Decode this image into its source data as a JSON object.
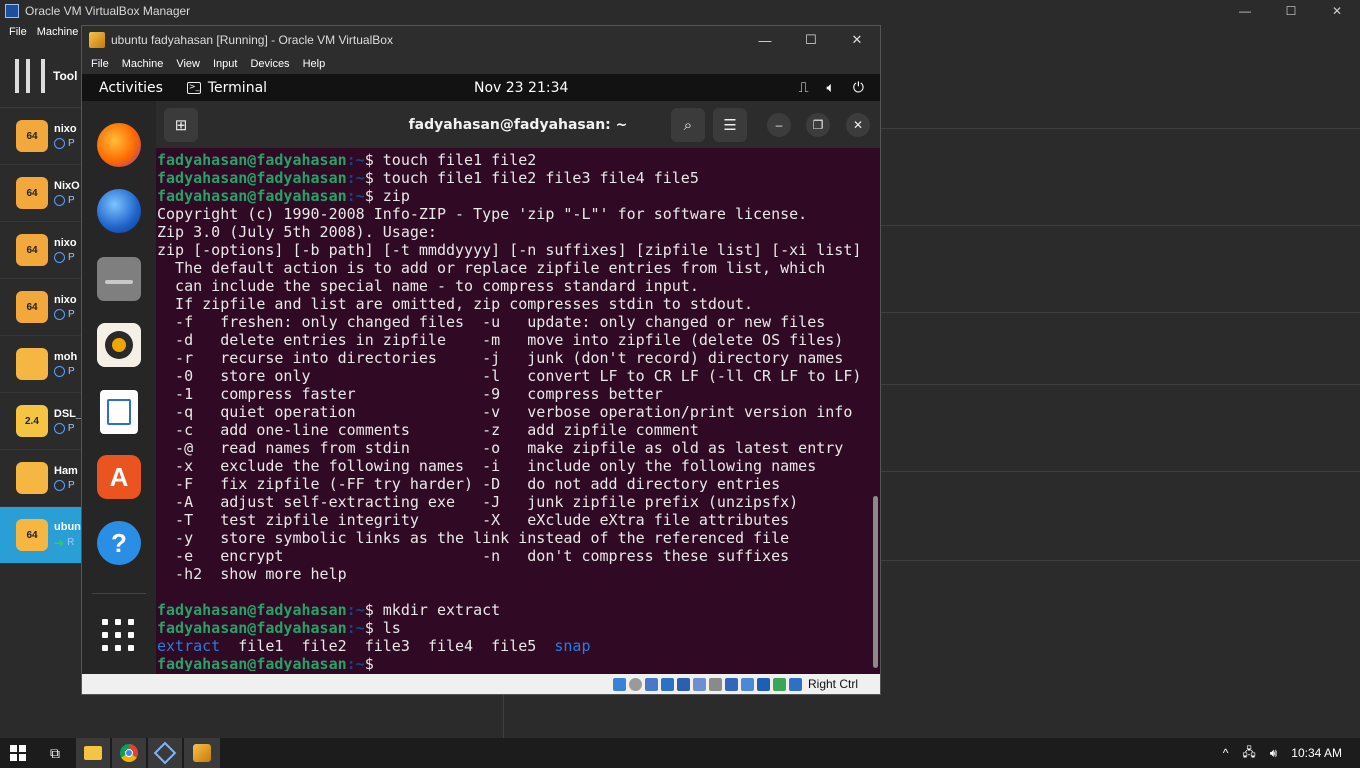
{
  "host": {
    "title": "Oracle VM VirtualBox Manager",
    "menu": [
      "File",
      "Machine"
    ],
    "tools_label": "Tool",
    "vms": [
      {
        "name": "nixo",
        "state": "P",
        "badge": "64",
        "color": "#f2a83a"
      },
      {
        "name": "NixO",
        "state": "P",
        "badge": "64",
        "color": "#f2a83a"
      },
      {
        "name": "nixo",
        "state": "P",
        "badge": "64",
        "color": "#f2a83a"
      },
      {
        "name": "nixo",
        "state": "P",
        "badge": "64",
        "color": "#f2a83a"
      },
      {
        "name": "moh",
        "state": "P",
        "badge": "",
        "color": "#f5b642"
      },
      {
        "name": "DSL_",
        "state": "P",
        "badge": "2.4",
        "color": "#f5c542"
      },
      {
        "name": "Ham",
        "state": "P",
        "badge": "",
        "color": "#f5b642"
      },
      {
        "name": "ubun",
        "state": "R",
        "badge": "64",
        "color": "#f5b642",
        "selected": true
      }
    ],
    "window_controls": {
      "minimize": "—",
      "maximize": "☐",
      "close": "✕"
    }
  },
  "vm_window": {
    "title": "ubuntu fadyahasan [Running] - Oracle VM VirtualBox",
    "menu": [
      "File",
      "Machine",
      "View",
      "Input",
      "Devices",
      "Help"
    ],
    "window_controls": {
      "minimize": "—",
      "maximize": "☐",
      "close": "✕"
    },
    "status_host_key": "Right Ctrl"
  },
  "gnome": {
    "activities": "Activities",
    "app_name": "Terminal",
    "clock": "Nov 23  21:34"
  },
  "dock": [
    "firefox-icon",
    "thunderbird-icon",
    "files-icon",
    "rhythmbox-icon",
    "writer-icon",
    "software-icon",
    "help-icon"
  ],
  "terminal": {
    "title": "fadyahasan@fadyahasan: ~",
    "user": "fadyahasan@fadyahasan",
    "path": ":~",
    "lines": [
      {
        "kind": "cmd",
        "text": "$ touch file1 file2"
      },
      {
        "kind": "cmd",
        "text": "$ touch file1 file2 file3 file4 file5"
      },
      {
        "kind": "cmd",
        "text": "$ zip"
      },
      {
        "kind": "out",
        "text": "Copyright (c) 1990-2008 Info-ZIP - Type 'zip \"-L\"' for software license."
      },
      {
        "kind": "out",
        "text": "Zip 3.0 (July 5th 2008). Usage:"
      },
      {
        "kind": "out",
        "text": "zip [-options] [-b path] [-t mmddyyyy] [-n suffixes] [zipfile list] [-xi list]"
      },
      {
        "kind": "out",
        "text": "  The default action is to add or replace zipfile entries from list, which"
      },
      {
        "kind": "out",
        "text": "  can include the special name - to compress standard input."
      },
      {
        "kind": "out",
        "text": "  If zipfile and list are omitted, zip compresses stdin to stdout."
      },
      {
        "kind": "out",
        "text": "  -f   freshen: only changed files  -u   update: only changed or new files"
      },
      {
        "kind": "out",
        "text": "  -d   delete entries in zipfile    -m   move into zipfile (delete OS files)"
      },
      {
        "kind": "out",
        "text": "  -r   recurse into directories     -j   junk (don't record) directory names"
      },
      {
        "kind": "out",
        "text": "  -0   store only                   -l   convert LF to CR LF (-ll CR LF to LF)"
      },
      {
        "kind": "out",
        "text": "  -1   compress faster              -9   compress better"
      },
      {
        "kind": "out",
        "text": "  -q   quiet operation              -v   verbose operation/print version info"
      },
      {
        "kind": "out",
        "text": "  -c   add one-line comments        -z   add zipfile comment"
      },
      {
        "kind": "out",
        "text": "  -@   read names from stdin        -o   make zipfile as old as latest entry"
      },
      {
        "kind": "out",
        "text": "  -x   exclude the following names  -i   include only the following names"
      },
      {
        "kind": "out",
        "text": "  -F   fix zipfile (-FF try harder) -D   do not add directory entries"
      },
      {
        "kind": "out",
        "text": "  -A   adjust self-extracting exe   -J   junk zipfile prefix (unzipsfx)"
      },
      {
        "kind": "out",
        "text": "  -T   test zipfile integrity       -X   eXclude eXtra file attributes"
      },
      {
        "kind": "out",
        "text": "  -y   store symbolic links as the link instead of the referenced file"
      },
      {
        "kind": "out",
        "text": "  -e   encrypt                      -n   don't compress these suffixes"
      },
      {
        "kind": "out",
        "text": "  -h2  show more help"
      },
      {
        "kind": "out",
        "text": ""
      },
      {
        "kind": "cmd",
        "text": "$ mkdir extract"
      },
      {
        "kind": "cmd",
        "text": "$ ls"
      },
      {
        "kind": "ls",
        "items": [
          {
            "name": "extract",
            "dir": true
          },
          {
            "name": "file1",
            "dir": false
          },
          {
            "name": "file2",
            "dir": false
          },
          {
            "name": "file3",
            "dir": false
          },
          {
            "name": "file4",
            "dir": false
          },
          {
            "name": "file5",
            "dir": false
          },
          {
            "name": "snap",
            "dir": true
          }
        ]
      },
      {
        "kind": "cmd",
        "text": "$ "
      }
    ]
  },
  "taskbar": {
    "time": "10:34 AM",
    "apps": [
      "windows-start-icon",
      "task-view-icon",
      "file-explorer-icon",
      "chrome-icon",
      "virtualbox-icon",
      "vm-running-icon"
    ]
  }
}
